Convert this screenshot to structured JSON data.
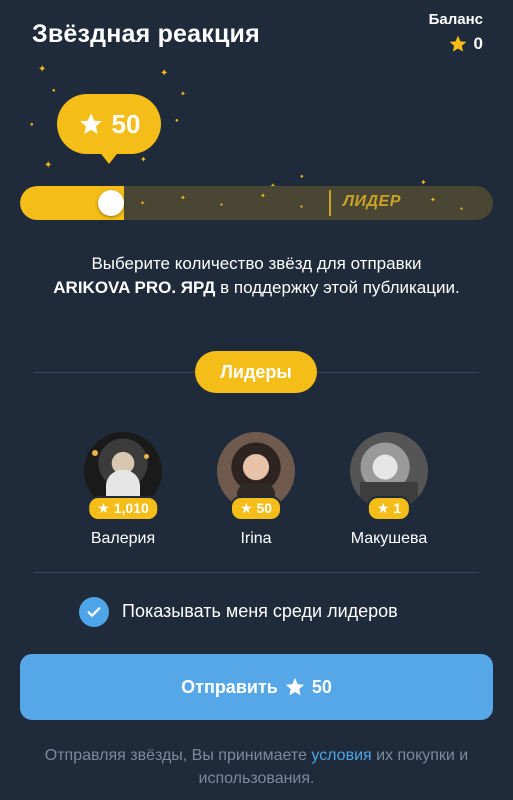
{
  "header": {
    "title": "Звёздная реакция",
    "balance_label": "Баланс",
    "balance_value": "0",
    "balance_icon": "star-icon"
  },
  "slider": {
    "bubble_value": "50",
    "bubble_icon": "star-icon",
    "leader_text": "ЛИДЕР",
    "fill_fraction": 0.22
  },
  "description": {
    "line1": "Выберите количество звёзд для отправки",
    "channel": "ARIKOVA PRO. ЯРД",
    "rest": " в поддержку этой публикации."
  },
  "leaders": {
    "pill_label": "Лидеры",
    "items": [
      {
        "name": "Валерия",
        "stars": "1,010"
      },
      {
        "name": "Irina",
        "stars": "50"
      },
      {
        "name": "Макушева",
        "stars": "1"
      }
    ]
  },
  "show_me": {
    "label": "Показывать меня среди лидеров",
    "checked": true
  },
  "send_button": {
    "label": "Отправить",
    "value": "50",
    "icon": "star-icon"
  },
  "footer": {
    "prefix": "Отправляя звёзды, Вы принимаете ",
    "link": "условия",
    "suffix": " их покупки и использования."
  },
  "colors": {
    "background": "#1f2b3a",
    "accent_gold": "#f5bd17",
    "accent_blue": "#55a7e8"
  }
}
